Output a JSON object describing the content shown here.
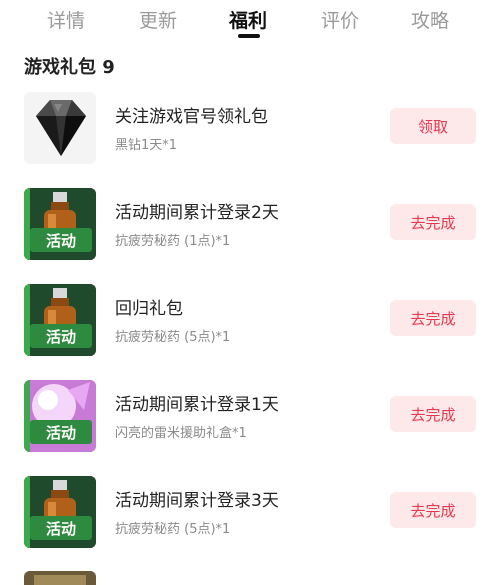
{
  "tabs": [
    {
      "label": "详情"
    },
    {
      "label": "更新"
    },
    {
      "label": "福利",
      "active": true
    },
    {
      "label": "评价"
    },
    {
      "label": "攻略"
    }
  ],
  "section": {
    "title": "游戏礼包 9"
  },
  "items": [
    {
      "name": "关注游戏官号领礼包",
      "reward": "黑钻1天*1",
      "button": "领取",
      "icon": "black-diamond-icon"
    },
    {
      "name": "活动期间累计登录2天",
      "reward": "抗疲劳秘药 (1点)*1",
      "button": "去完成",
      "icon": "potion-event-icon",
      "badge": "活动"
    },
    {
      "name": "回归礼包",
      "reward": "抗疲劳秘药 (5点)*1",
      "button": "去完成",
      "icon": "potion-event-icon",
      "badge": "活动"
    },
    {
      "name": "活动期间累计登录1天",
      "reward": "闪亮的雷米援助礼盒*1",
      "button": "去完成",
      "icon": "pink-giftbox-event-icon",
      "badge": "活动"
    },
    {
      "name": "活动期间累计登录3天",
      "reward": "抗疲劳秘药 (5点)*1",
      "button": "去完成",
      "icon": "potion-event-icon",
      "badge": "活动"
    }
  ],
  "colors": {
    "accent": "#e5394f",
    "button_bg": "#fde8ea",
    "text": "#222222",
    "muted": "#8a8a8a"
  }
}
